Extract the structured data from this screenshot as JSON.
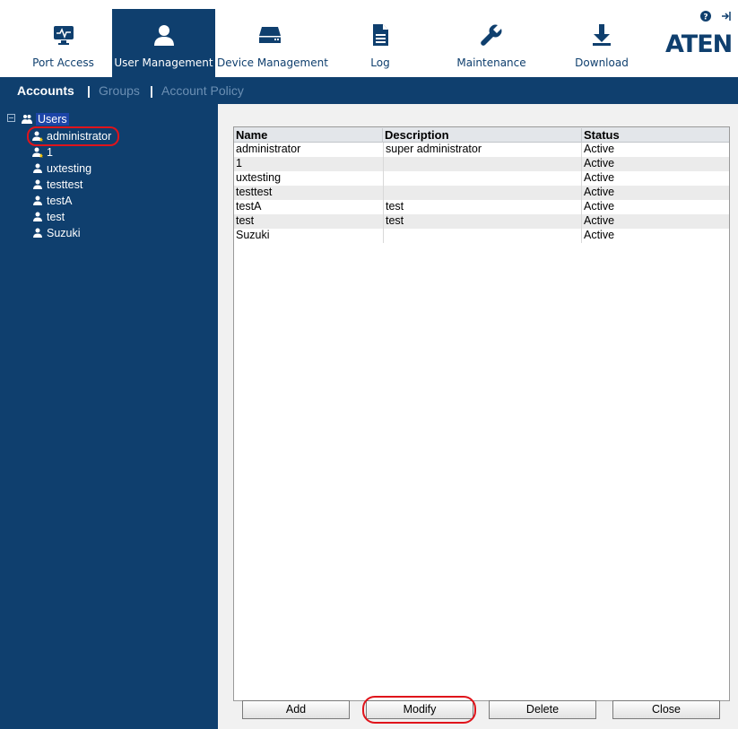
{
  "nav": {
    "items": [
      {
        "label": "Port Access",
        "icon": "monitor-pulse-icon"
      },
      {
        "label": "User Management",
        "icon": "user-icon"
      },
      {
        "label": "Device Management",
        "icon": "device-icon"
      },
      {
        "label": "Log",
        "icon": "document-icon"
      },
      {
        "label": "Maintenance",
        "icon": "wrench-icon"
      },
      {
        "label": "Download",
        "icon": "download-icon"
      }
    ],
    "active_item": "User Management",
    "logo_text": "ATEN",
    "help_icon": "help-icon",
    "logout_icon": "logout-icon"
  },
  "subnav": {
    "accounts": "Accounts",
    "groups": "Groups",
    "account_policy": "Account Policy",
    "separator": "|"
  },
  "sidebar": {
    "root": "Users",
    "users": [
      "administrator",
      "1",
      "uxtesting",
      "testtest",
      "testA",
      "test",
      "Suzuki"
    ]
  },
  "table": {
    "columns": [
      "Name",
      "Description",
      "Status"
    ],
    "rows": [
      [
        "administrator",
        "super administrator",
        "Active"
      ],
      [
        "1",
        "",
        "Active"
      ],
      [
        "uxtesting",
        "",
        "Active"
      ],
      [
        "testtest",
        "",
        "Active"
      ],
      [
        "testA",
        "test",
        "Active"
      ],
      [
        "test",
        "test",
        "Active"
      ],
      [
        "Suzuki",
        "",
        "Active"
      ]
    ]
  },
  "buttons": {
    "add": "Add",
    "modify": "Modify",
    "delete": "Delete",
    "close": "Close"
  },
  "colors": {
    "brand": "#0f3f6e",
    "highlight": "#e0141b"
  }
}
